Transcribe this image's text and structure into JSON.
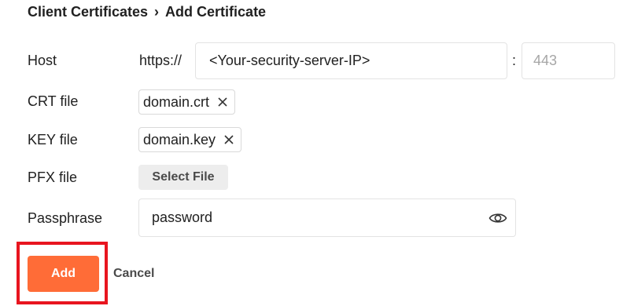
{
  "breadcrumb": {
    "parent": "Client Certificates",
    "separator": "›",
    "current": "Add Certificate"
  },
  "form": {
    "host": {
      "label": "Host",
      "prefix": "https://",
      "value": "<Your-security-server-IP>",
      "colon": ":",
      "port_placeholder": "443"
    },
    "crt": {
      "label": "CRT file",
      "file": "domain.crt"
    },
    "key": {
      "label": "KEY file",
      "file": "domain.key"
    },
    "pfx": {
      "label": "PFX file",
      "button": "Select File"
    },
    "passphrase": {
      "label": "Passphrase",
      "value": "password"
    }
  },
  "actions": {
    "add_label": "Add",
    "cancel_label": "Cancel"
  },
  "colors": {
    "accent": "#ff6c37",
    "highlight": "#e8151f",
    "border": "#e3e3e3"
  },
  "icons": {
    "remove": "close-icon",
    "visibility": "eye-icon"
  }
}
